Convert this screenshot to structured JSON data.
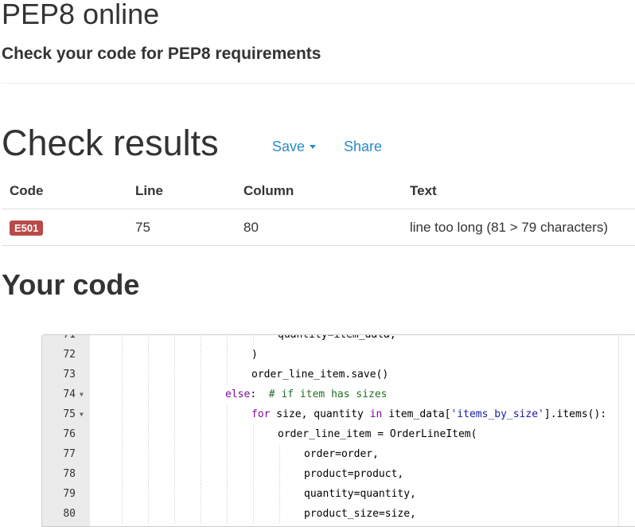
{
  "header": {
    "title": "PEP8 online",
    "subtitle": "Check your code for PEP8 requirements"
  },
  "results": {
    "title": "Check results",
    "save_label": "Save",
    "share_label": "Share",
    "columns": [
      "Code",
      "Line",
      "Column",
      "Text"
    ],
    "rows": [
      {
        "code": "E501",
        "line": "75",
        "column": "80",
        "text": "line too long (81 > 79 characters)"
      }
    ],
    "badge_color": "#b94a48",
    "link_color": "#2a8bc9"
  },
  "code_section": {
    "title": "Your code",
    "lines": [
      {
        "num": "71",
        "fold": false,
        "indent": 7,
        "parts": [
          [
            "plain",
            "quantity=item_data,"
          ]
        ]
      },
      {
        "num": "72",
        "fold": false,
        "indent": 6,
        "parts": [
          [
            "plain",
            ")"
          ]
        ]
      },
      {
        "num": "73",
        "fold": false,
        "indent": 6,
        "parts": [
          [
            "plain",
            "order_line_item.save()"
          ]
        ]
      },
      {
        "num": "74",
        "fold": true,
        "indent": 5,
        "parts": [
          [
            "kw",
            "else"
          ],
          [
            "plain",
            ":  "
          ],
          [
            "comment",
            "# if item has sizes"
          ]
        ]
      },
      {
        "num": "75",
        "fold": true,
        "indent": 6,
        "parts": [
          [
            "kw",
            "for"
          ],
          [
            "plain",
            " size, quantity "
          ],
          [
            "kw",
            "in"
          ],
          [
            "plain",
            " item_data["
          ],
          [
            "str",
            "'items_by_size'"
          ],
          [
            "plain",
            "].items():"
          ]
        ]
      },
      {
        "num": "76",
        "fold": false,
        "indent": 7,
        "parts": [
          [
            "plain",
            "order_line_item = OrderLineItem("
          ]
        ]
      },
      {
        "num": "77",
        "fold": false,
        "indent": 8,
        "parts": [
          [
            "plain",
            "order=order,"
          ]
        ]
      },
      {
        "num": "78",
        "fold": false,
        "indent": 8,
        "parts": [
          [
            "plain",
            "product=product,"
          ]
        ]
      },
      {
        "num": "79",
        "fold": false,
        "indent": 8,
        "parts": [
          [
            "plain",
            "quantity=quantity,"
          ]
        ]
      },
      {
        "num": "80",
        "fold": false,
        "indent": 8,
        "parts": [
          [
            "plain",
            "product_size=size,"
          ]
        ]
      }
    ]
  }
}
